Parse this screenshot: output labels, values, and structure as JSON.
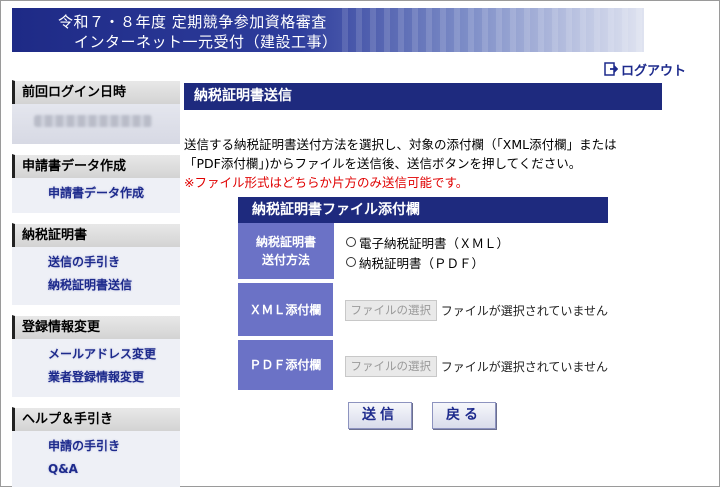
{
  "header": {
    "title_line1": "令和７・８年度 定期競争参加資格審査",
    "title_line2": "インターネット一元受付（建設工事）",
    "logout_label": "ログアウト",
    "logout_icon": "logout-icon"
  },
  "sidebar": {
    "last_login_title": "前回ログイン日時",
    "sections": [
      {
        "title": "申請書データ作成",
        "items": [
          "申請書データ作成"
        ]
      },
      {
        "title": "納税証明書",
        "items": [
          "送信の手引き",
          "納税証明書送信"
        ]
      },
      {
        "title": "登録情報変更",
        "items": [
          "メールアドレス変更",
          "業者登録情報変更"
        ]
      },
      {
        "title": "ヘルプ＆手引き",
        "items": [
          "申請の手引き",
          "Q&A"
        ]
      }
    ]
  },
  "main": {
    "title": "納税証明書送信",
    "desc_line1": "送信する納税証明書送付方法を選択し、対象の添付欄（「XML添付欄」または",
    "desc_line2": "「PDF添付欄」)からファイルを送信後、送信ボタンを押してください。",
    "warning": "※ファイル形式はどちらか片方のみ送信可能です。",
    "form_title": "納税証明書ファイル添付欄",
    "method_label_line1": "納税証明書",
    "method_label_line2": "送付方法",
    "radio_options": [
      "電子納税証明書（ＸＭＬ）",
      "納税証明書（ＰＤＦ）"
    ],
    "xml_label": "ＸＭＬ添付欄",
    "pdf_label": "ＰＤＦ添付欄",
    "file_button_label": "ファイルの選択",
    "file_status": "ファイルが選択されていません",
    "send_button": "送信",
    "back_button": "戻る"
  },
  "colors": {
    "accent": "#1e2a7e",
    "label_bg": "#6b72c6",
    "link": "#1d2a8c",
    "warning": "#e00000"
  }
}
